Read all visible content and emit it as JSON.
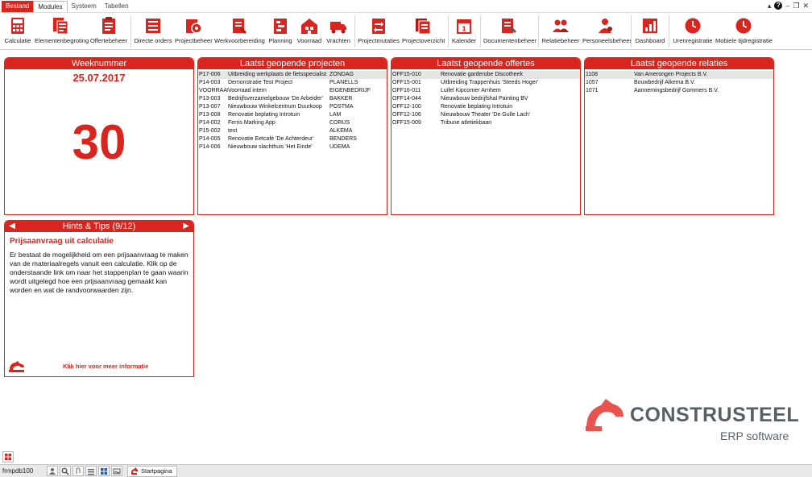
{
  "menubar": {
    "tabs": [
      "Bestand",
      "Modules",
      "Systeem",
      "Tabellen"
    ],
    "window_controls": [
      "minimize-icon",
      "help-icon",
      "restore-icon",
      "maximize-icon",
      "close-icon"
    ]
  },
  "ribbon": {
    "buttons": [
      {
        "label": "Calculatie",
        "icon": "calculator-icon"
      },
      {
        "label": "Elementenbegroting",
        "icon": "element-budget-icon"
      },
      {
        "label": "Offertebeheer",
        "icon": "quote-icon"
      },
      {
        "label": "Directe orders",
        "icon": "orders-icon"
      },
      {
        "label": "Projectbeheer",
        "icon": "project-gear-icon"
      },
      {
        "label": "Werkvoorbereiding",
        "icon": "preparation-icon"
      },
      {
        "label": "Planning",
        "icon": "planning-icon"
      },
      {
        "label": "Voorraad",
        "icon": "warehouse-icon"
      },
      {
        "label": "Vrachten",
        "icon": "truck-icon"
      },
      {
        "label": "Projectmutaties",
        "icon": "mutations-icon"
      },
      {
        "label": "Projectoverzicht",
        "icon": "overview-icon"
      },
      {
        "label": "Kalender",
        "icon": "calendar-icon"
      },
      {
        "label": "Documentenbeheer",
        "icon": "documents-icon"
      },
      {
        "label": "Relatiebeheer",
        "icon": "relations-icon"
      },
      {
        "label": "Personeelsbeheer",
        "icon": "staff-icon"
      },
      {
        "label": "Dashboard",
        "icon": "dashboard-icon"
      },
      {
        "label": "Urenregistratie",
        "icon": "clock-icon"
      },
      {
        "label": "Mobiele tijdregistratie",
        "icon": "mobile-clock-icon"
      }
    ]
  },
  "week_panel": {
    "title": "Weeknummer",
    "date": "25.07.2017",
    "number": "30"
  },
  "projects_panel": {
    "title": "Laatst geopende projecten",
    "rows": [
      [
        "P17-006",
        "Uitbreiding werkplaats de fietsspecialist",
        "ZONDAG"
      ],
      [
        "P14-003",
        "Demonstratie Test Project",
        "PLANELLS"
      ],
      [
        "VOORRAAD",
        "Voorraad intern",
        "EIGENBEDRIJF"
      ],
      [
        "P13-003",
        "Bedrijfsverzamelgebouw 'De Arbeider'",
        "BAKKER"
      ],
      [
        "P13-007",
        "Nieuwbouw Winkelcentrum Duurkoop",
        "POSTMA"
      ],
      [
        "P13-008",
        "Renovatie beplating Introtuin",
        "LAM"
      ],
      [
        "P14-002",
        "Ferris Marking App",
        "CORUS"
      ],
      [
        "P15-002",
        "test",
        "ALKEMA"
      ],
      [
        "P14-005",
        "Renovatie Eetcafé 'De Achterdeur'",
        "BENDERS"
      ],
      [
        "P14-006",
        "Nieuwbouw slachthuis 'Het Einde'",
        "UDEMA"
      ]
    ]
  },
  "offers_panel": {
    "title": "Laatst geopende offertes",
    "rows": [
      [
        "OFF15-010",
        "Renovatie garderobe Discotheek"
      ],
      [
        "OFF15-001",
        "Uitbreiding Trappenhuis 'Steeds Hoger'"
      ],
      [
        "OFF16-011",
        "Luifel Kipcorner Arnhem"
      ],
      [
        "OFF14-044",
        "Nieuwbouw bedrijfshal Painting BV"
      ],
      [
        "OFF12-100",
        "Renovatie beplating Introtuin"
      ],
      [
        "OFF12-106",
        "Nieuwbouw Theater 'De Gulle Lach'"
      ],
      [
        "OFF15-009",
        "Tribune atletiekbaan"
      ]
    ]
  },
  "relations_panel": {
    "title": "Laatst geopende relaties",
    "rows": [
      [
        "1108",
        "Van Amerongen Projects B.V."
      ],
      [
        "1057",
        "Bouwbedrijf Alkema B.V."
      ],
      [
        "1071",
        "Aannemingsbedrijf Gommers B.V."
      ]
    ]
  },
  "hints_panel": {
    "title": "Hints & Tips (9/12)",
    "heading": "Prijsaanvraag uit calculatie",
    "body": "Er bestaat de mogelijkheid om een prijsaanvraag te maken van de materiaalregels vanuit een calculatie. Klik op de onderstaande link om naar het stappenplan te gaan waarin wordt uitgelegd hoe een prijsaanvraag gemaakt kan worden en wat de randvoorwaarden zijn.",
    "link": "Klik hier voor meer informatie"
  },
  "brand": {
    "name": "CONSTRUSTEEL",
    "sub": "ERP software"
  },
  "statusbar": {
    "form": "frmpdb100",
    "tab": "Startpagina"
  },
  "colors": {
    "accent": "#d9251d",
    "brand_grey": "#5a5f66"
  }
}
